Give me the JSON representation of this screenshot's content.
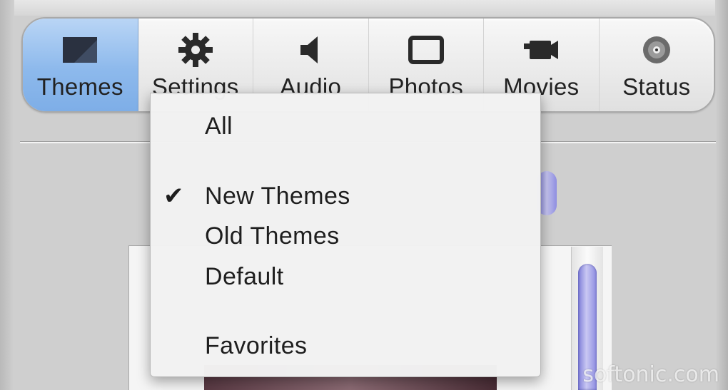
{
  "toolbar": {
    "items": [
      {
        "label": "Themes",
        "icon": "themes-icon",
        "selected": true
      },
      {
        "label": "Settings",
        "icon": "gear-icon",
        "selected": false
      },
      {
        "label": "Audio",
        "icon": "speaker-icon",
        "selected": false
      },
      {
        "label": "Photos",
        "icon": "photo-frame-icon",
        "selected": false
      },
      {
        "label": "Movies",
        "icon": "movie-camera-icon",
        "selected": false
      },
      {
        "label": "Status",
        "icon": "disc-icon",
        "selected": false
      }
    ]
  },
  "menu": {
    "items": [
      {
        "label": "All",
        "checked": false
      },
      {
        "label": "New Themes",
        "checked": true
      },
      {
        "label": "Old Themes",
        "checked": false
      },
      {
        "label": "Default",
        "checked": false
      },
      {
        "label": "Favorites",
        "checked": false
      }
    ],
    "check_glyph": "✔"
  },
  "watermark": "softonic.com",
  "colors": {
    "selected_tab": "#8db9ec",
    "scroll_accent": "#8c8be0"
  }
}
